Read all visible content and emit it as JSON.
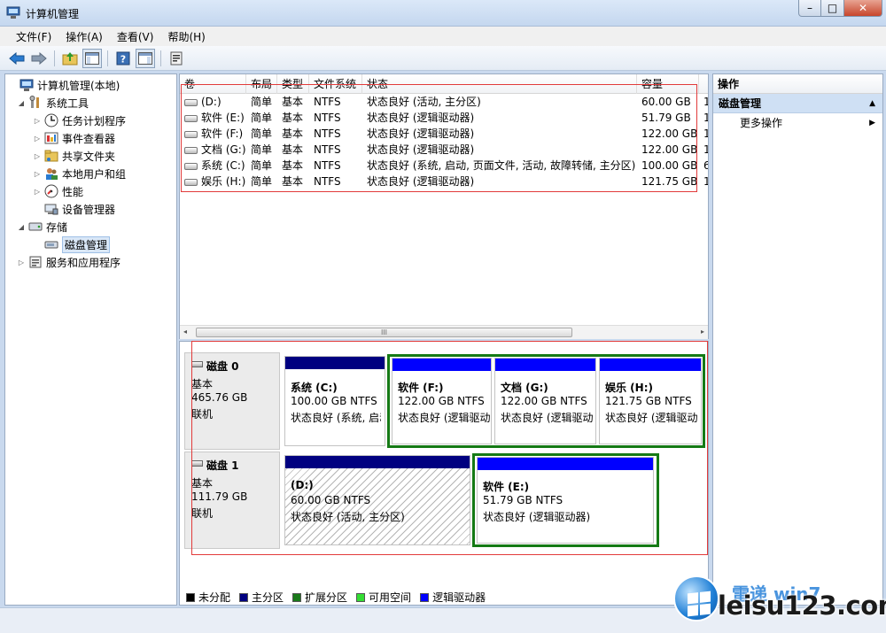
{
  "window": {
    "title": "计算机管理",
    "min_glyph": "–",
    "max_glyph": "□",
    "close_glyph": "✕"
  },
  "menu": [
    "文件(F)",
    "操作(A)",
    "查看(V)",
    "帮助(H)"
  ],
  "toolbar": {
    "back": "←",
    "forward": "→",
    "help_glyph": "?"
  },
  "tree": {
    "root": "计算机管理(本地)",
    "system_tools": "系统工具",
    "task_scheduler": "任务计划程序",
    "event_viewer": "事件查看器",
    "shared_folders": "共享文件夹",
    "local_users": "本地用户和组",
    "performance": "性能",
    "device_manager": "设备管理器",
    "storage": "存储",
    "disk_management": "磁盘管理",
    "services_apps": "服务和应用程序"
  },
  "volumes": {
    "headers": [
      "卷",
      "布局",
      "类型",
      "文件系统",
      "状态",
      "容量",
      ""
    ],
    "rows": [
      [
        "(D:)",
        "简单",
        "基本",
        "NTFS",
        "状态良好 (活动, 主分区)",
        "60.00 GB",
        "1"
      ],
      [
        "软件 (E:)",
        "简单",
        "基本",
        "NTFS",
        "状态良好 (逻辑驱动器)",
        "51.79 GB",
        "1"
      ],
      [
        "软件 (F:)",
        "简单",
        "基本",
        "NTFS",
        "状态良好 (逻辑驱动器)",
        "122.00 GB",
        "1"
      ],
      [
        "文档 (G:)",
        "简单",
        "基本",
        "NTFS",
        "状态良好 (逻辑驱动器)",
        "122.00 GB",
        "1"
      ],
      [
        "系统 (C:)",
        "简单",
        "基本",
        "NTFS",
        "状态良好 (系统, 启动, 页面文件, 活动, 故障转储, 主分区)",
        "100.00 GB",
        "6"
      ],
      [
        "娱乐 (H:)",
        "简单",
        "基本",
        "NTFS",
        "状态良好 (逻辑驱动器)",
        "121.75 GB",
        "1"
      ]
    ],
    "scroll_grip": "III",
    "scroll_left": "◂",
    "scroll_right": "▸"
  },
  "disks": [
    {
      "name": "磁盘 0",
      "type": "基本",
      "size": "465.76 GB",
      "status": "联机",
      "partitions": [
        {
          "title": "系统  (C:)",
          "size": "100.00 GB NTFS",
          "status": "状态良好 (系统, 启动"
        },
        {
          "title": "软件  (F:)",
          "size": "122.00 GB NTFS",
          "status": "状态良好 (逻辑驱动"
        },
        {
          "title": "文档  (G:)",
          "size": "122.00 GB NTFS",
          "status": "状态良好 (逻辑驱动"
        },
        {
          "title": "娱乐  (H:)",
          "size": "121.75 GB NTFS",
          "status": "状态良好 (逻辑驱动"
        }
      ]
    },
    {
      "name": "磁盘 1",
      "type": "基本",
      "size": "111.79 GB",
      "status": "联机",
      "partitions": [
        {
          "title": "(D:)",
          "size": "60.00 GB NTFS",
          "status": "状态良好 (活动, 主分区)"
        },
        {
          "title": "软件  (E:)",
          "size": "51.79 GB NTFS",
          "status": "状态良好 (逻辑驱动器)"
        }
      ]
    }
  ],
  "legend": [
    {
      "label": "未分配",
      "color": "#000000"
    },
    {
      "label": "主分区",
      "color": "#000080"
    },
    {
      "label": "扩展分区",
      "color": "#1a7a1a"
    },
    {
      "label": "可用空间",
      "color": "#33dd33"
    },
    {
      "label": "逻辑驱动器",
      "color": "#0000ff"
    }
  ],
  "actions": {
    "header": "操作",
    "section": "磁盘管理",
    "collapse_glyph": "▲",
    "more": "更多操作",
    "more_arrow": "▶"
  },
  "watermark": {
    "text": "leisu123.com",
    "sub": "雷递 win7"
  },
  "colors": {
    "primary_partition": "#000080",
    "logical_drive": "#0000ff",
    "extended_partition": "#157a15",
    "annotation": "#e23b3b"
  }
}
